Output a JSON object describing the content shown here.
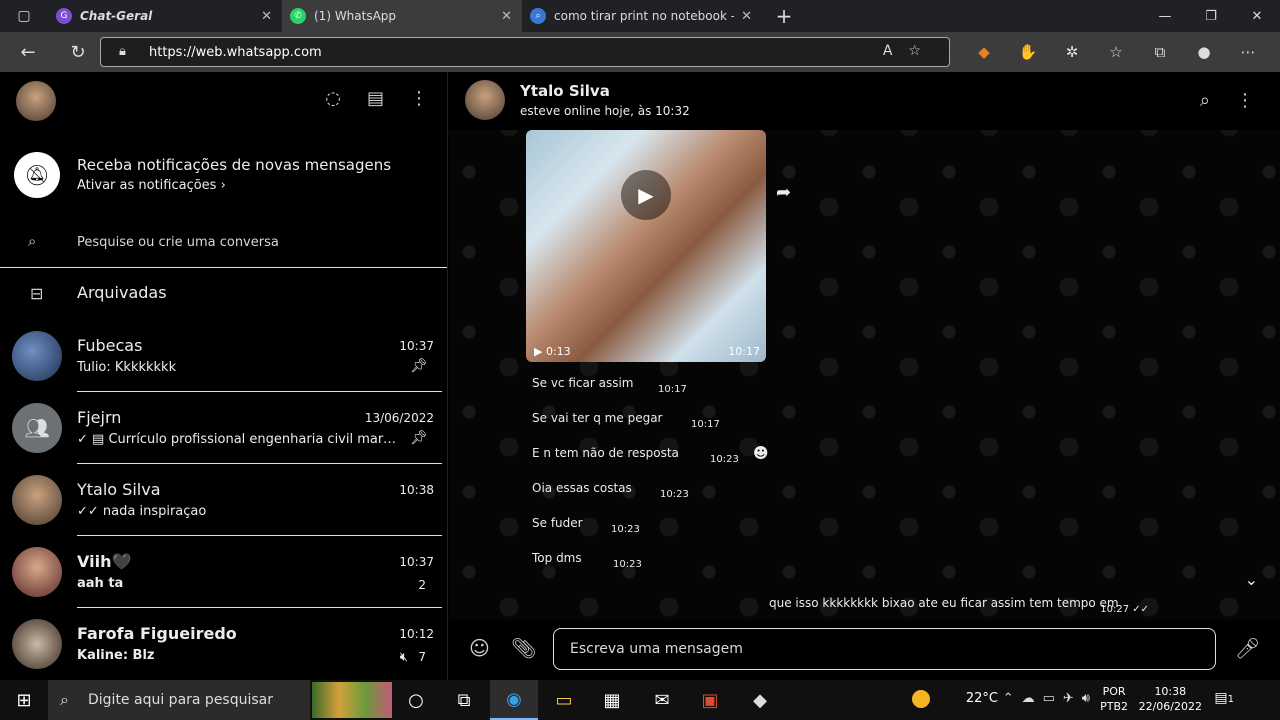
{
  "browser": {
    "tabs": [
      {
        "label": "Chat-Geral",
        "favicon_color": "#7b4ed6"
      },
      {
        "label": "(1) WhatsApp",
        "favicon_color": "#25d366"
      },
      {
        "label": "como tirar print no notebook - P",
        "favicon_color": "#3a78d8"
      }
    ],
    "url": "https://web.whatsapp.com"
  },
  "sidebar": {
    "notification": {
      "title": "Receba notificações de novas mensagens",
      "action": "Ativar as notificações ›"
    },
    "search_placeholder": "Pesquise ou crie uma conversa",
    "archived_label": "Arquivadas",
    "chats": [
      {
        "name": "Fubecas",
        "time": "10:37",
        "message": "Tulio: Kkkkkkkk",
        "pinned": true
      },
      {
        "name": "Fjejrn",
        "time": "13/06/2022",
        "message": "✓ ▤ Currículo profissional engenharia civil marrom ...",
        "pinned": true
      },
      {
        "name": "Ytalo Silva",
        "time": "10:38",
        "message": "✓✓ nada inspiraçao"
      },
      {
        "name": "Viih🖤",
        "time": "10:37",
        "message": "aah ta",
        "badge": "2"
      },
      {
        "name": "Farofa Figueiredo",
        "time": "10:12",
        "message": "Kaline: Blz",
        "badge": "7",
        "muted": true
      }
    ]
  },
  "conversation": {
    "contact_name": "Ytalo Silva",
    "status": "esteve online hoje, às 10:32",
    "video": {
      "duration": "0:13",
      "time": "10:17"
    },
    "messages": [
      {
        "text": "Se vc ficar assim",
        "time": "10:17"
      },
      {
        "text": "Se vai ter q me pegar",
        "time": "10:17"
      },
      {
        "text": "E n tem não de resposta",
        "time": "10:23"
      },
      {
        "text": "Oia essas costas",
        "time": "10:23"
      },
      {
        "text": "Se fuder",
        "time": "10:23"
      },
      {
        "text": "Top dms",
        "time": "10:23"
      }
    ],
    "outgoing": {
      "text": "que isso kkkkkkkk bixao ate eu ficar assim tem tempo em",
      "time": "10:27 ✓✓"
    },
    "composer_placeholder": "Escreva uma mensagem"
  },
  "taskbar": {
    "search_placeholder": "Digite aqui para pesquisar",
    "weather": "22°C",
    "lang_top": "POR",
    "lang_bottom": "PTB2",
    "time": "10:38",
    "date": "22/06/2022",
    "notif_count": "1"
  }
}
